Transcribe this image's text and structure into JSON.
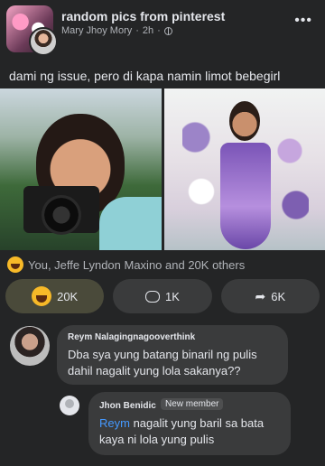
{
  "header": {
    "group_name": "random pics from pinterest",
    "poster": "Mary Jhoy Mory",
    "time": "2h",
    "more_icon": "more-horizontal-icon"
  },
  "post": {
    "caption": "dami ng issue, pero di kapa namin limot bebegirl"
  },
  "reactions": {
    "summary": "You, Jeffe Lyndon Maxino and 20K others",
    "reaction_icon": "haha-icon"
  },
  "actions": {
    "react_count": "20K",
    "comment_count": "1K",
    "share_count": "6K"
  },
  "comments": [
    {
      "author": "Reym Nalagingnagooverthink",
      "text": "Dba sya yung batang binaril ng pulis dahil nagalit yung lola sakanya??"
    },
    {
      "author": "Jhon Benidic",
      "badge": "New member",
      "mention": "Reym",
      "text": " nagalit yung baril sa bata kaya ni lola yung pulis"
    }
  ],
  "colors": {
    "background": "#242526",
    "bubble": "#3a3b3c",
    "mention": "#4599ff",
    "haha": "#f7b928"
  }
}
